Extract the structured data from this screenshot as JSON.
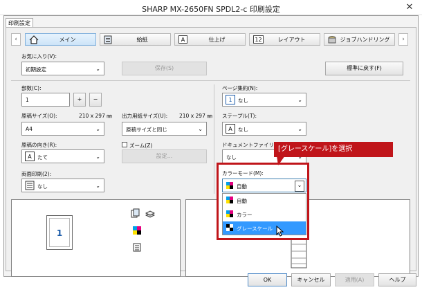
{
  "window": {
    "title": "SHARP MX-2650FN SPDL2-c 印刷設定",
    "close_glyph": "✕"
  },
  "tab": {
    "label": "印刷設定"
  },
  "nav": {
    "prev": "‹",
    "next": "›",
    "items": [
      {
        "label": "メイン",
        "icon": "home-icon",
        "active": true
      },
      {
        "label": "給紙",
        "icon": "paper-tray-icon",
        "active": false
      },
      {
        "label": "仕上げ",
        "icon": "finishing-icon",
        "active": false
      },
      {
        "label": "レイアウト",
        "icon": "layout-icon",
        "active": false
      },
      {
        "label": "ジョブハンドリング",
        "icon": "job-handling-icon",
        "active": false
      }
    ]
  },
  "favorites": {
    "label": "お気に入り(V):",
    "value": "初期設定",
    "save_label": "保存(S)",
    "reset_label": "標準に戻す(F)"
  },
  "copies": {
    "label": "部数(C):",
    "value": "1",
    "plus": "+",
    "minus": "−"
  },
  "original_size": {
    "label": "原稿サイズ(O):",
    "dims": "210 x 297 ㎜",
    "value": "A4"
  },
  "output_size": {
    "label": "出力用紙サイズ(U):",
    "dims": "210 x 297 ㎜",
    "value": "原稿サイズと同じ"
  },
  "orientation": {
    "label": "原稿の向き(R):",
    "value": "たて",
    "icon_glyph": "A"
  },
  "zoom": {
    "label": "ズーム(Z)",
    "settings_label": "設定..."
  },
  "duplex": {
    "label": "両面印刷(2):",
    "value": "なし"
  },
  "page_collate": {
    "label": "ページ集約(N):",
    "value": "なし",
    "icon_glyph": "1"
  },
  "staple": {
    "label": "ステープル(T):",
    "value": "なし",
    "icon_glyph": "A"
  },
  "doc_filing": {
    "label": "ドキュメントファイリング",
    "value": "なし"
  },
  "color_mode": {
    "label": "カラーモード(M):",
    "value": "自動",
    "options": [
      {
        "label": "自動",
        "selected": false
      },
      {
        "label": "カラー",
        "selected": false
      },
      {
        "label": "グレースケール",
        "selected": true
      }
    ]
  },
  "callout": {
    "text": "[グレースケール]を選択"
  },
  "preview": {
    "page_number": "1"
  },
  "footer": {
    "ok": "OK",
    "cancel": "キャンセル",
    "apply": "適用(A)",
    "help": "ヘルプ"
  },
  "colors": {
    "accent": "#c0151a",
    "selection": "#3399ff",
    "active_tab": "#cde4f8"
  }
}
